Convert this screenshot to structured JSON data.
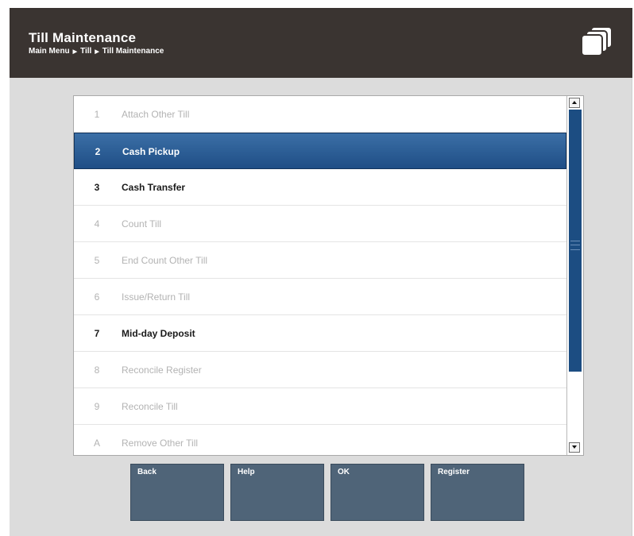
{
  "header": {
    "title": "Till Maintenance",
    "breadcrumb": [
      "Main Menu",
      "Till",
      "Till Maintenance"
    ]
  },
  "menu": {
    "items": [
      {
        "num": "1",
        "label": "Attach Other Till",
        "state": "disabled"
      },
      {
        "num": "2",
        "label": "Cash Pickup",
        "state": "selected"
      },
      {
        "num": "3",
        "label": "Cash Transfer",
        "state": "enabled"
      },
      {
        "num": "4",
        "label": "Count Till",
        "state": "disabled"
      },
      {
        "num": "5",
        "label": "End Count Other Till",
        "state": "disabled"
      },
      {
        "num": "6",
        "label": "Issue/Return Till",
        "state": "disabled"
      },
      {
        "num": "7",
        "label": "Mid-day Deposit",
        "state": "enabled"
      },
      {
        "num": "8",
        "label": "Reconcile Register",
        "state": "disabled"
      },
      {
        "num": "9",
        "label": "Reconcile Till",
        "state": "disabled"
      },
      {
        "num": "A",
        "label": "Remove Other Till",
        "state": "disabled"
      }
    ]
  },
  "buttons": {
    "back": "Back",
    "help": "Help",
    "ok": "OK",
    "register": "Register"
  },
  "colors": {
    "header_bg": "#3a3431",
    "selected_row": "#2a5a92",
    "scrollbar_thumb": "#1c4d82",
    "button_bg": "#4f6478"
  },
  "icons": {
    "header": "stacked-windows-icon"
  }
}
